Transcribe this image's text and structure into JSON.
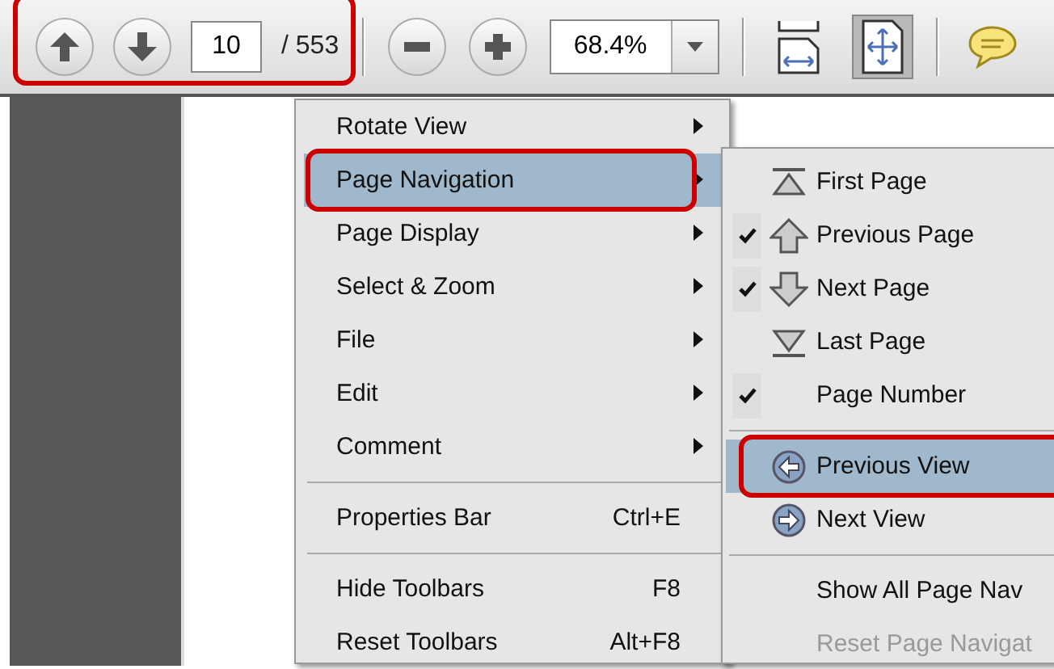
{
  "toolbar": {
    "callout": true,
    "page_number": "10",
    "page_count": "/ 553",
    "zoom": "68.4%",
    "fit_page_selected": true
  },
  "context_menu": {
    "items": [
      {
        "kind": "item",
        "label": "Rotate View",
        "submenu": true,
        "selected": false,
        "callout": false
      },
      {
        "kind": "item",
        "label": "Page Navigation",
        "submenu": true,
        "selected": true,
        "callout": true
      },
      {
        "kind": "item",
        "label": "Page Display",
        "submenu": true,
        "selected": false,
        "callout": false
      },
      {
        "kind": "item",
        "label": "Select & Zoom",
        "submenu": true,
        "selected": false,
        "callout": false
      },
      {
        "kind": "item",
        "label": "File",
        "submenu": true,
        "selected": false,
        "callout": false
      },
      {
        "kind": "item",
        "label": "Edit",
        "submenu": true,
        "selected": false,
        "callout": false
      },
      {
        "kind": "item",
        "label": "Comment",
        "submenu": true,
        "selected": false,
        "callout": false
      },
      {
        "kind": "separator"
      },
      {
        "kind": "item",
        "label": "Properties Bar",
        "shortcut": "Ctrl+E",
        "submenu": false,
        "selected": false,
        "callout": false
      },
      {
        "kind": "separator"
      },
      {
        "kind": "item",
        "label": "Hide Toolbars",
        "shortcut": "F8",
        "submenu": false,
        "selected": false,
        "callout": false
      },
      {
        "kind": "item",
        "label": "Reset Toolbars",
        "shortcut": "Alt+F8",
        "submenu": false,
        "selected": false,
        "callout": false
      }
    ]
  },
  "submenu": {
    "items": [
      {
        "kind": "first",
        "label": "First Page",
        "checked": false,
        "selected": false,
        "disabled": false,
        "callout": false
      },
      {
        "kind": "up",
        "label": "Previous Page",
        "checked": true,
        "selected": false,
        "disabled": false,
        "callout": false
      },
      {
        "kind": "down",
        "label": "Next Page",
        "checked": true,
        "selected": false,
        "disabled": false,
        "callout": false
      },
      {
        "kind": "last",
        "label": "Last Page",
        "checked": false,
        "selected": false,
        "disabled": false,
        "callout": false
      },
      {
        "kind": "plain",
        "label": "Page Number",
        "checked": true,
        "selected": false,
        "disabled": false,
        "callout": false
      },
      {
        "kind": "separator"
      },
      {
        "kind": "back",
        "label": "Previous View",
        "checked": false,
        "selected": true,
        "disabled": false,
        "callout": true
      },
      {
        "kind": "forward",
        "label": "Next View",
        "checked": false,
        "selected": false,
        "disabled": false,
        "callout": false
      },
      {
        "kind": "separator"
      },
      {
        "kind": "plain",
        "label": "Show All Page Nav",
        "checked": false,
        "selected": false,
        "disabled": false,
        "callout": false
      },
      {
        "kind": "plain",
        "label": "Reset Page Navigat",
        "checked": false,
        "selected": false,
        "disabled": true,
        "callout": false
      }
    ]
  }
}
